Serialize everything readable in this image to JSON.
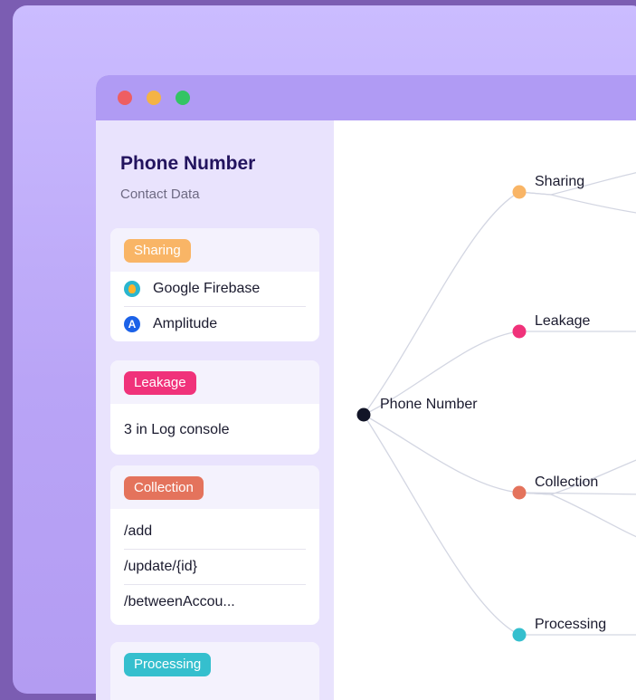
{
  "sidebar": {
    "title": "Phone Number",
    "subtitle": "Contact Data",
    "cards": {
      "sharing": {
        "tag": "Sharing",
        "color": "#f9b566",
        "items": [
          {
            "label": "Google Firebase",
            "icon": "firebase-icon"
          },
          {
            "label": "Amplitude",
            "icon": "amplitude-icon"
          }
        ]
      },
      "leakage": {
        "tag": "Leakage",
        "color": "#f0327a",
        "items": [
          "3 in Log console"
        ]
      },
      "collection": {
        "tag": "Collection",
        "color": "#e4735c",
        "items": [
          "/add",
          "/update/{id}",
          "/betweenAccou..."
        ]
      },
      "processing": {
        "tag": "Processing",
        "color": "#35bfce"
      }
    }
  },
  "graph": {
    "root": "Phone Number",
    "branches": [
      "Sharing",
      "Leakage",
      "Collection",
      "Processing"
    ]
  },
  "window": {
    "controls": [
      "close",
      "minimize",
      "maximize"
    ]
  }
}
